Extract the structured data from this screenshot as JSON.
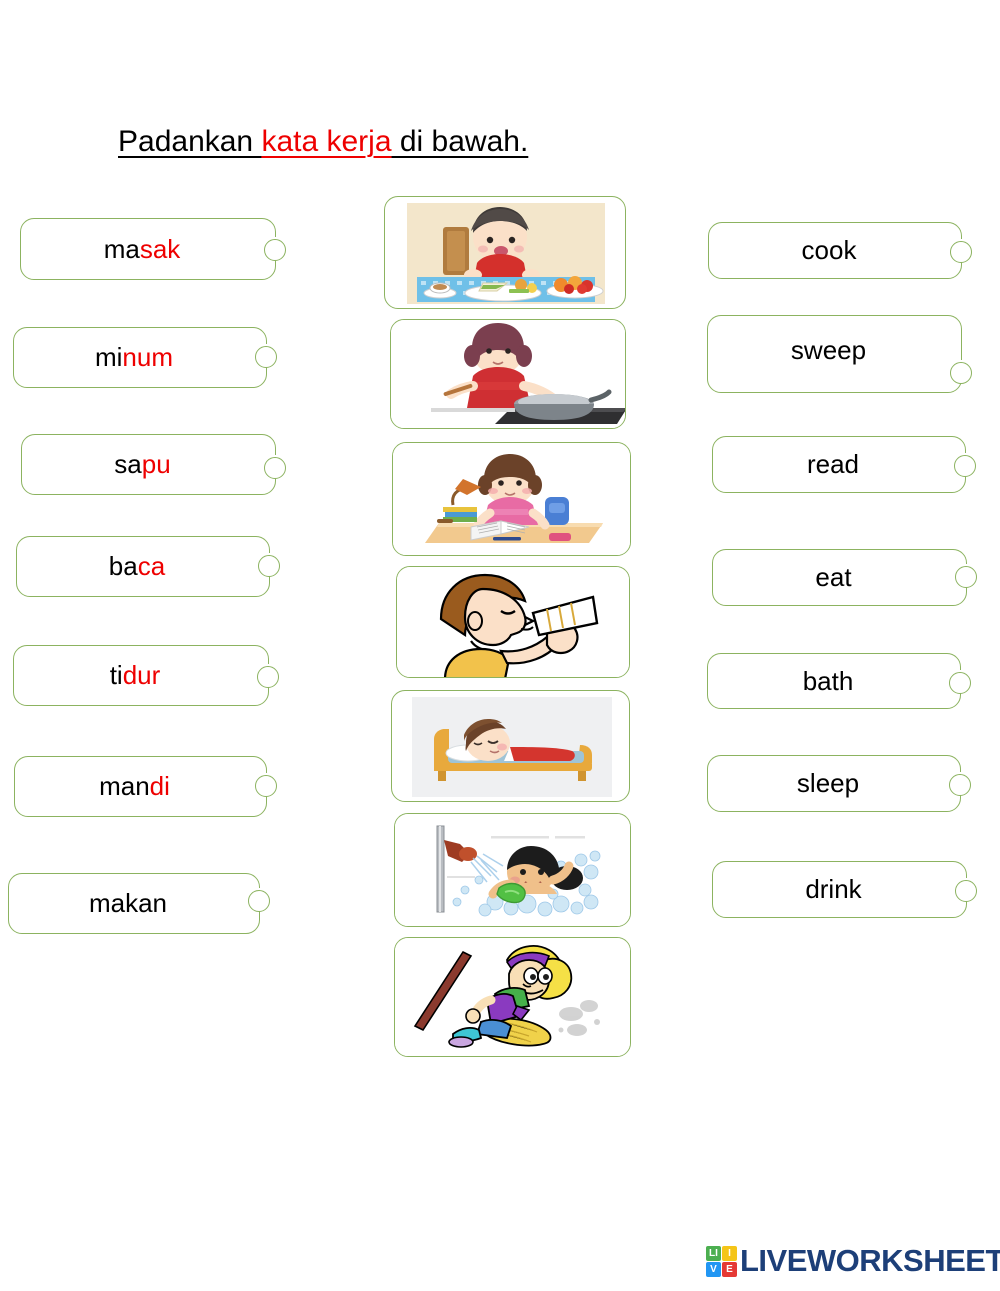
{
  "title": {
    "part1": "Padankan ",
    "part2": "kata kerja",
    "part3": " di bawah."
  },
  "colors": {
    "box_border": "#8cb360",
    "accent_red": "#ee0000",
    "text": "#000000",
    "logo_navy": "#1d3f78"
  },
  "malay_words": [
    {
      "black": "ma",
      "red": "sak"
    },
    {
      "black": "mi",
      "red": "num"
    },
    {
      "black": "sa",
      "red": "pu"
    },
    {
      "black": "ba",
      "red": "ca"
    },
    {
      "black": "ti",
      "red": "dur"
    },
    {
      "black": "man",
      "red": "di"
    },
    {
      "black": "makan",
      "red": ""
    }
  ],
  "english_words": [
    {
      "label": "cook"
    },
    {
      "label": "sweep"
    },
    {
      "label": "read"
    },
    {
      "label": "eat"
    },
    {
      "label": "bath"
    },
    {
      "label": "sleep"
    },
    {
      "label": "drink"
    }
  ],
  "pictures": [
    {
      "alt": "boy eating a meal at a table"
    },
    {
      "alt": "woman cooking with a pan on a stove"
    },
    {
      "alt": "child reading a book at a desk with a lamp"
    },
    {
      "alt": "boy drinking from a glass"
    },
    {
      "alt": "child sleeping on a bed"
    },
    {
      "alt": "child taking a bath under a shower"
    },
    {
      "alt": "girl sweeping with a broom"
    }
  ],
  "footer": {
    "logo_tiles": [
      "LI",
      "I",
      "V",
      "E"
    ],
    "tile_letters": {
      "a": "LI",
      "b": "I",
      "c": "V",
      "d": "E"
    },
    "brand": "LIVEWORKSHEETS"
  }
}
